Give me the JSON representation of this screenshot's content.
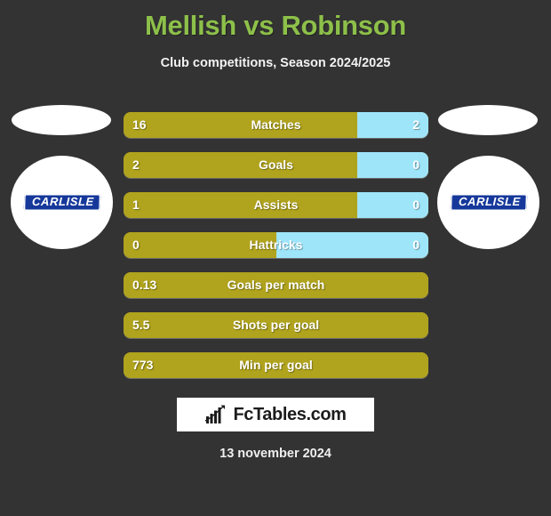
{
  "header": {
    "title": "Mellish vs Robinson",
    "subtitle": "Club competitions, Season 2024/2025",
    "title_color": "#8dc04a"
  },
  "teams": {
    "left": {
      "badge_label": "CARLISLE",
      "badge_name": "carlisle-badge-left"
    },
    "right": {
      "badge_label": "CARLISLE",
      "badge_name": "carlisle-badge-right"
    }
  },
  "colors": {
    "background": "#333333",
    "home_bar": "#b0a31d",
    "away_bar": "#9fe5fa",
    "text": "#ffffff",
    "logo_blue": "#16389b"
  },
  "footer": {
    "brand": "FcTables.com",
    "brand_icon": "bar-chart-growth-icon",
    "date": "13 november 2024"
  },
  "chart_data": {
    "type": "bar",
    "title": "Mellish vs Robinson",
    "subtitle": "Club competitions, Season 2024/2025",
    "xlabel": "",
    "ylabel": "",
    "legend": [
      "Mellish",
      "Robinson"
    ],
    "legend_position": "none",
    "grid": false,
    "orientation": "horizontal-split-bars",
    "categories": [
      "Matches",
      "Goals",
      "Assists",
      "Hattricks",
      "Goals per match",
      "Shots per goal",
      "Min per goal"
    ],
    "series": [
      {
        "name": "Mellish",
        "color": "#b0a31d",
        "values": [
          16,
          2,
          1,
          0,
          0.13,
          5.5,
          773
        ]
      },
      {
        "name": "Robinson",
        "color": "#9fe5fa",
        "values": [
          2,
          0,
          0,
          0,
          null,
          null,
          null
        ]
      }
    ],
    "rows": [
      {
        "label": "Matches",
        "left_value": "16",
        "right_value": "2",
        "left_pct": 76.6,
        "has_right": true
      },
      {
        "label": "Goals",
        "left_value": "2",
        "right_value": "0",
        "left_pct": 76.6,
        "has_right": true
      },
      {
        "label": "Assists",
        "left_value": "1",
        "right_value": "0",
        "left_pct": 76.6,
        "has_right": true
      },
      {
        "label": "Hattricks",
        "left_value": "0",
        "right_value": "0",
        "left_pct": 50.0,
        "has_right": true
      },
      {
        "label": "Goals per match",
        "left_value": "0.13",
        "right_value": "",
        "left_pct": 100,
        "has_right": false
      },
      {
        "label": "Shots per goal",
        "left_value": "5.5",
        "right_value": "",
        "left_pct": 100,
        "has_right": false
      },
      {
        "label": "Min per goal",
        "left_value": "773",
        "right_value": "",
        "left_pct": 100,
        "has_right": false
      }
    ]
  }
}
